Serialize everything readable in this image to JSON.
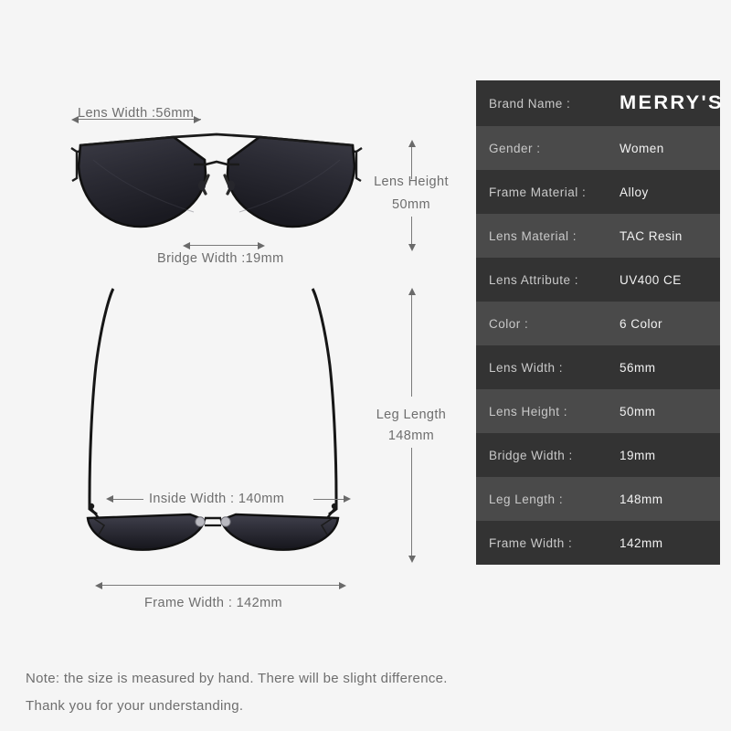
{
  "page": {
    "background_color": "#f5f5f5",
    "text_color": "#6e6e6e"
  },
  "diagram": {
    "front_view": {
      "lens_width_label": "Lens Width :56mm",
      "bridge_width_label": "Bridge Width :19mm",
      "lens_height_label_line1": "Lens Height",
      "lens_height_label_line2": "50mm"
    },
    "top_view": {
      "inside_width_label": "Inside  Width : 140mm",
      "frame_width_label": "Frame Width : 142mm",
      "leg_length_label_line1": "Leg Length",
      "leg_length_label_line2": "148mm"
    }
  },
  "spec_table": {
    "accent_dark": "#333333",
    "accent_light": "#4a4a4a",
    "brand": {
      "label": "Brand Name :",
      "value": "MERRY'S"
    },
    "rows": [
      {
        "label": "Gender :",
        "value": "Women"
      },
      {
        "label": "Frame Material :",
        "value": "Alloy"
      },
      {
        "label": "Lens Material :",
        "value": "TAC Resin"
      },
      {
        "label": "Lens Attribute :",
        "value": "UV400 CE"
      },
      {
        "label": "Color :",
        "value": "6 Color"
      },
      {
        "label": "Lens Width :",
        "value": "56mm"
      },
      {
        "label": "Lens Height :",
        "value": "50mm"
      },
      {
        "label": "Bridge Width :",
        "value": "19mm"
      },
      {
        "label": "Leg Length :",
        "value": "148mm"
      },
      {
        "label": "Frame Width :",
        "value": "142mm"
      }
    ]
  },
  "note": {
    "line1": "Note: the size is measured by hand. There will be slight difference.",
    "line2": "Thank you for your understanding."
  }
}
